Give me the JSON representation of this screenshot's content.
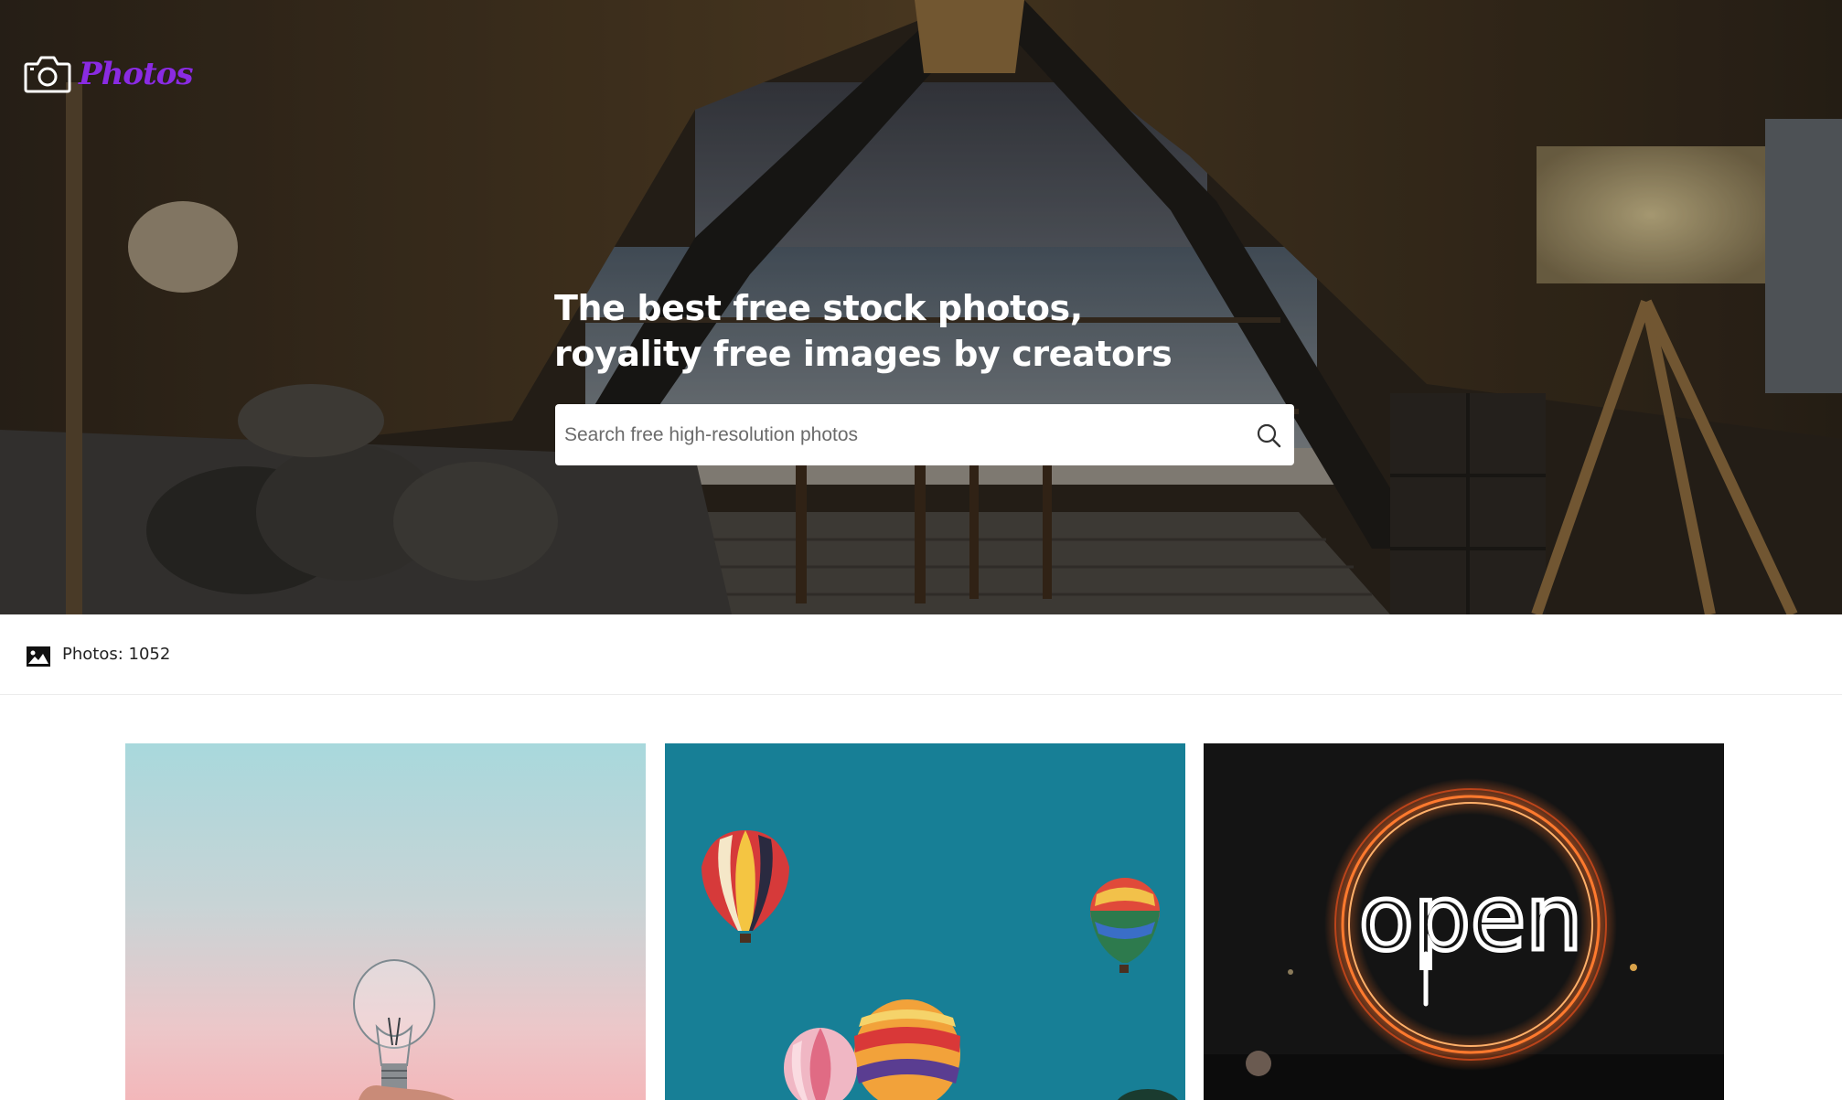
{
  "brand": {
    "name": "Photos",
    "icon": "camera-icon",
    "color": "#8a2be2"
  },
  "hero": {
    "title_line1": "The best free stock photos,",
    "title_line2": "royality free images by creators"
  },
  "search": {
    "placeholder": "Search free high-resolution photos",
    "value": "",
    "icon": "search-icon"
  },
  "stats": {
    "label": "Photos: 1052",
    "icon": "image-icon"
  },
  "photos": [
    {
      "subject": "lightbulb-photo",
      "sign_text": ""
    },
    {
      "subject": "hot-air-balloons-photo",
      "sign_text": ""
    },
    {
      "subject": "neon-open-sign-photo",
      "sign_text": "open"
    }
  ]
}
